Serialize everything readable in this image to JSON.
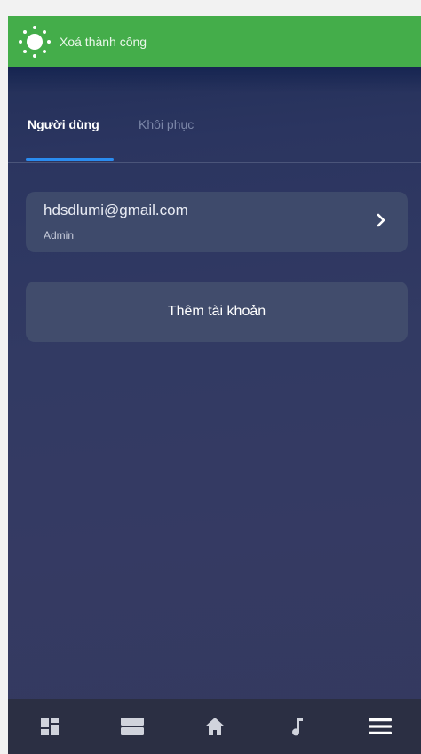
{
  "toast": {
    "message": "Xoá thành công",
    "icon": "sun-icon"
  },
  "tabs": [
    {
      "label": "Người dùng",
      "active": true
    },
    {
      "label": "Khôi phục",
      "active": false
    }
  ],
  "account": {
    "email": "hdsdlumi@gmail.com",
    "role": "Admin"
  },
  "add_account_label": "Thêm tài khoản",
  "bottom_nav": [
    {
      "icon": "dashboard-icon"
    },
    {
      "icon": "rooms-icon"
    },
    {
      "icon": "home-icon"
    },
    {
      "icon": "music-icon"
    },
    {
      "icon": "menu-icon"
    }
  ],
  "colors": {
    "toast": "#44ad4a",
    "accent": "#2a8cf0",
    "background": "#323a63",
    "nav": "#2b2f43"
  }
}
